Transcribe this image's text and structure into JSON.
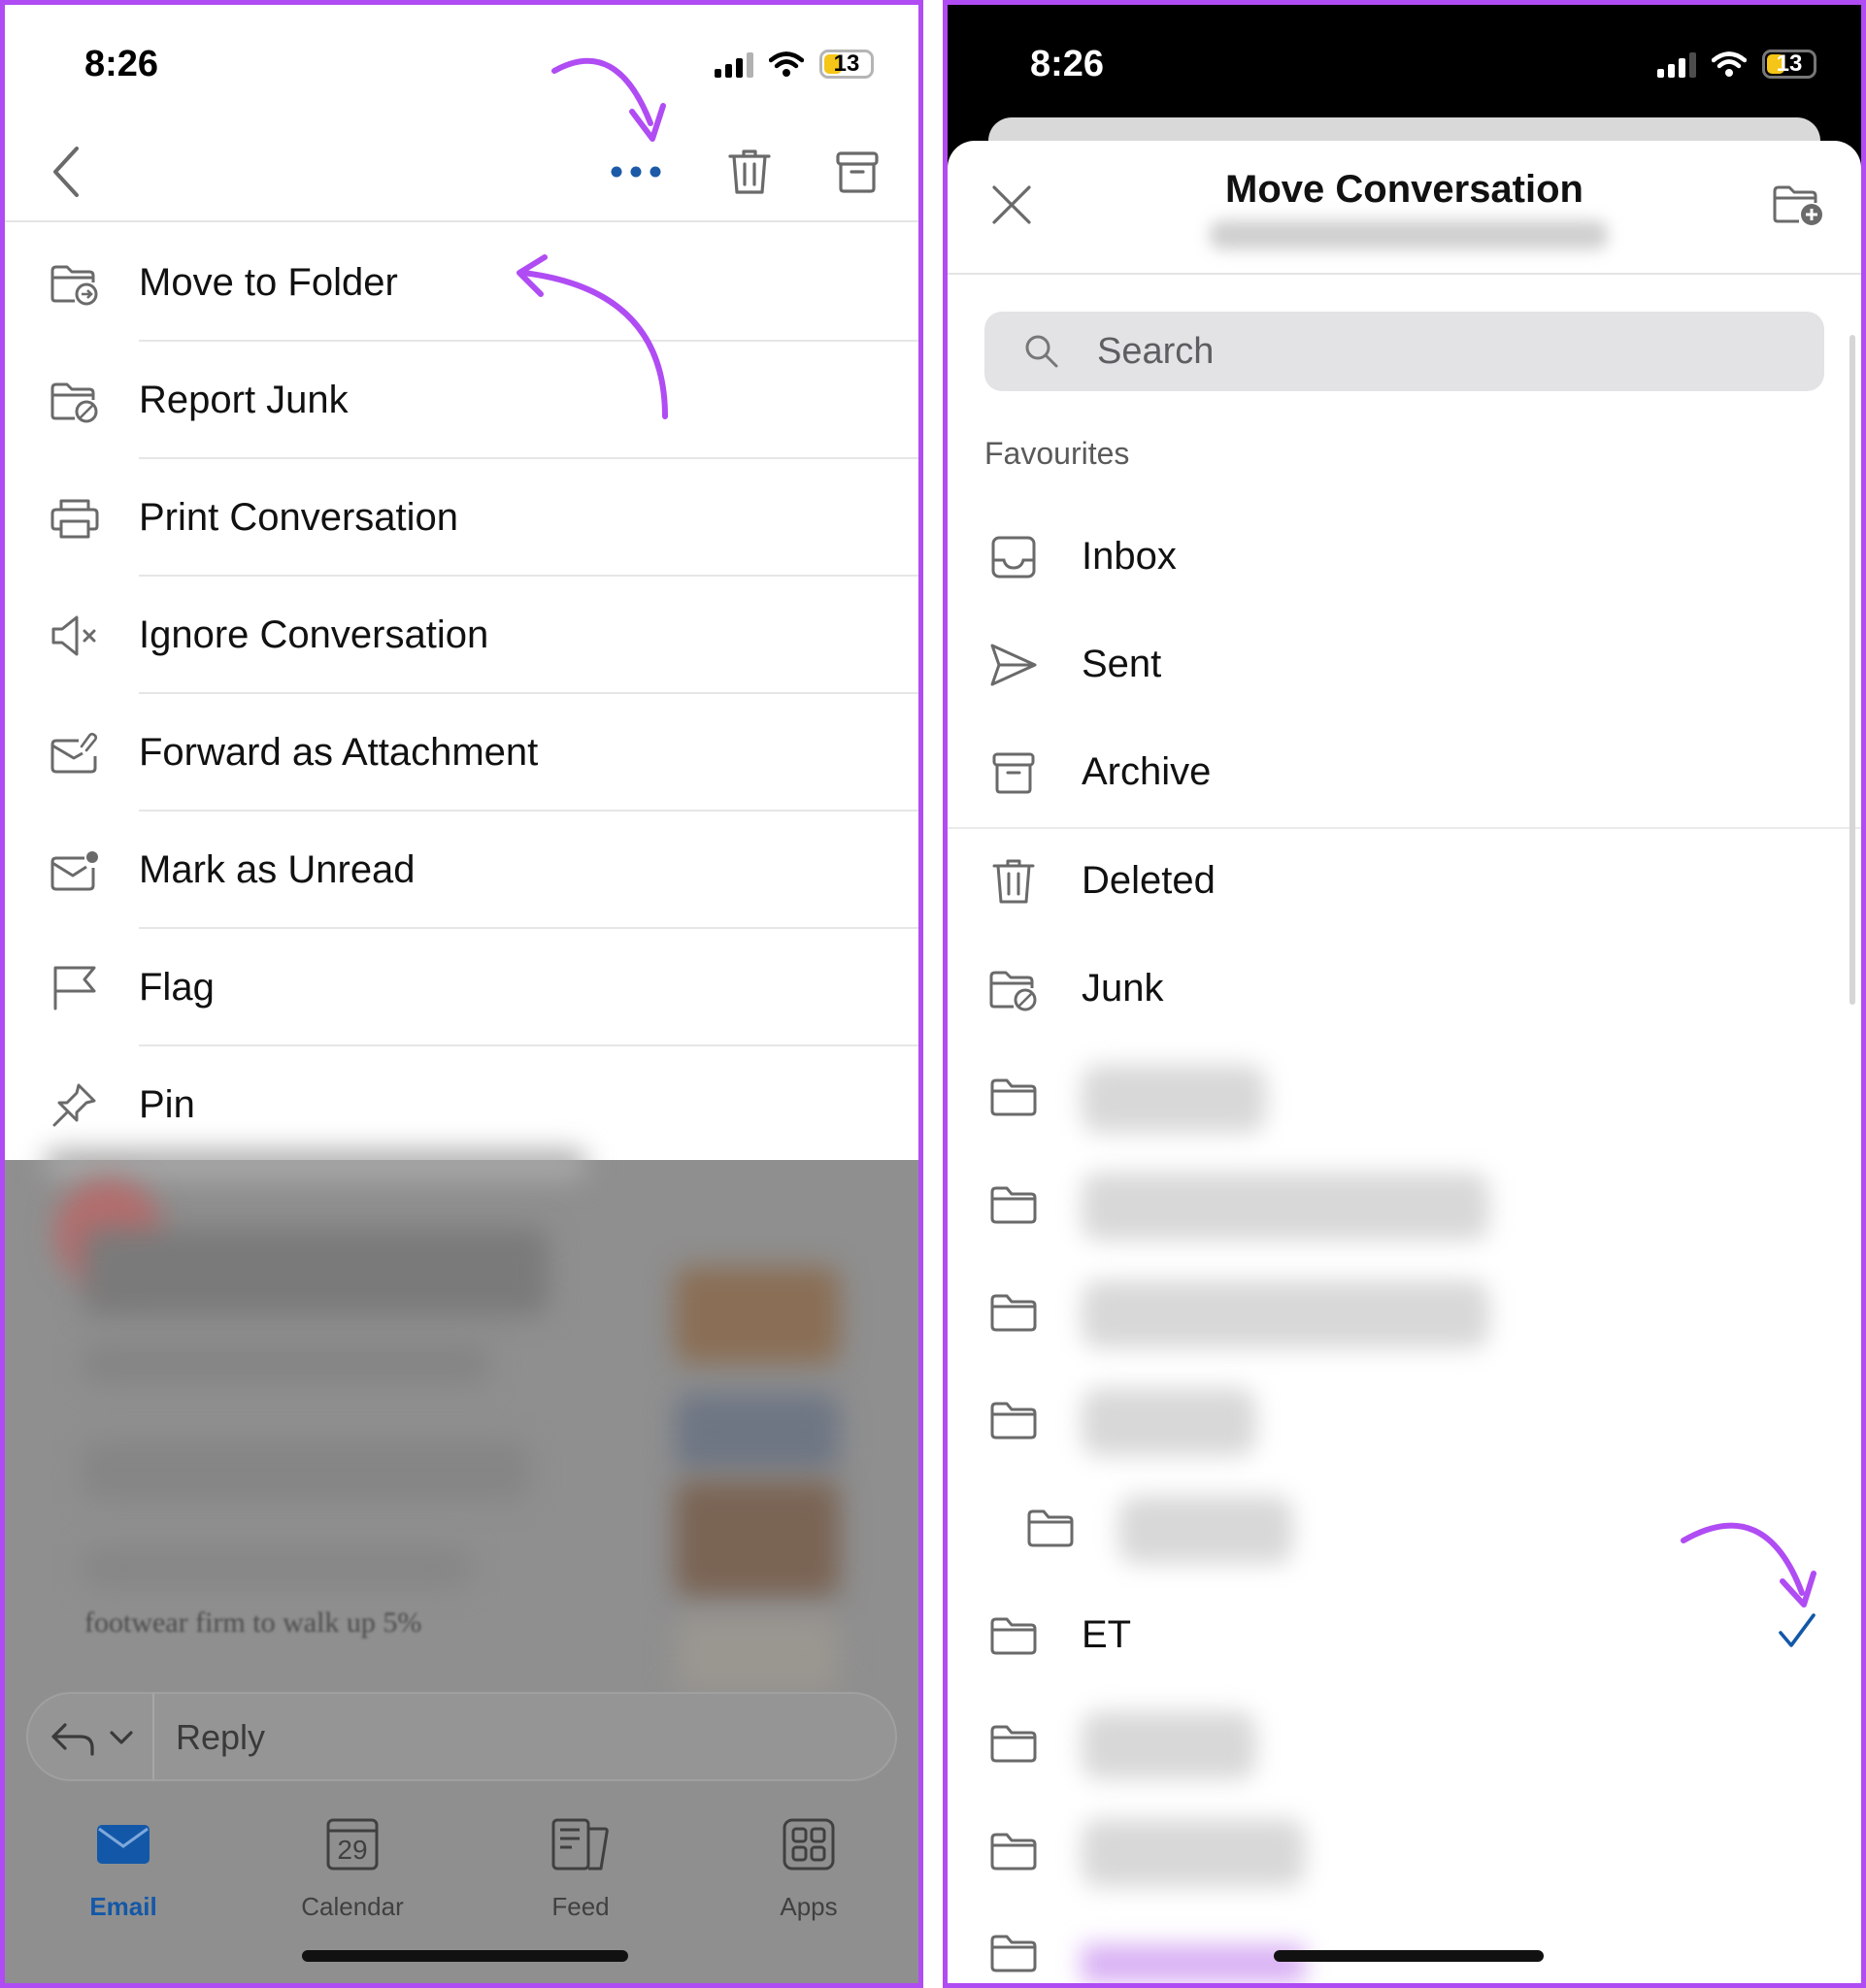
{
  "left_screen": {
    "status": {
      "time": "8:26",
      "battery": "13"
    },
    "toolbar": {
      "back_icon": "chevron-left-icon",
      "more_icon": "ellipsis-icon",
      "delete_icon": "trash-icon",
      "archive_icon": "archive-icon"
    },
    "menu": [
      {
        "label": "Move to Folder",
        "icon": "folder-move-icon"
      },
      {
        "label": "Report Junk",
        "icon": "folder-block-icon"
      },
      {
        "label": "Print Conversation",
        "icon": "printer-icon"
      },
      {
        "label": "Ignore Conversation",
        "icon": "speaker-mute-icon"
      },
      {
        "label": "Forward as Attachment",
        "icon": "mail-attach-icon"
      },
      {
        "label": "Mark as Unread",
        "icon": "mail-unread-icon"
      },
      {
        "label": "Flag",
        "icon": "flag-icon"
      },
      {
        "label": "Pin",
        "icon": "pin-icon"
      }
    ],
    "background_snippet": "footwear firm to walk up 5%",
    "reply": {
      "placeholder": "Reply"
    },
    "tabs": [
      {
        "label": "Email",
        "icon": "mail-icon",
        "active": true
      },
      {
        "label": "Calendar",
        "icon": "calendar-icon",
        "badge": "29"
      },
      {
        "label": "Feed",
        "icon": "feed-icon"
      },
      {
        "label": "Apps",
        "icon": "apps-grid-icon"
      }
    ]
  },
  "right_screen": {
    "status": {
      "time": "8:26",
      "battery": "13"
    },
    "header": {
      "title": "Move Conversation",
      "close_icon": "close-icon",
      "new_folder_icon": "folder-add-icon"
    },
    "search": {
      "placeholder": "Search"
    },
    "section": "Favourites",
    "folders": [
      {
        "label": "Inbox",
        "icon": "inbox-icon"
      },
      {
        "label": "Sent",
        "icon": "send-icon"
      },
      {
        "label": "Archive",
        "icon": "archive-icon"
      },
      {
        "label": "Deleted",
        "icon": "trash-icon"
      },
      {
        "label": "Junk",
        "icon": "folder-block-icon"
      },
      {
        "label": "ET",
        "icon": "folder-icon",
        "selected": true
      }
    ]
  },
  "colors": {
    "accent": "#1358a8",
    "annotation": "#b04cf3"
  }
}
